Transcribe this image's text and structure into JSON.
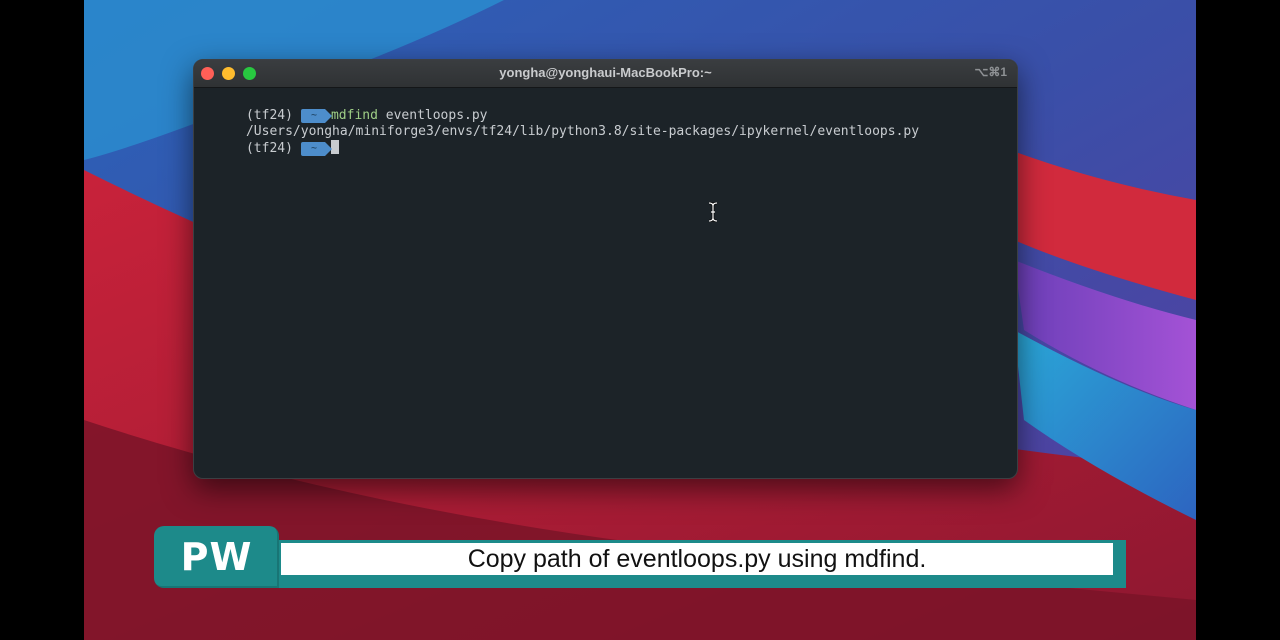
{
  "window": {
    "title": "yongha@yonghaui-MacBookPro:~",
    "shortcut": "⌥⌘1"
  },
  "terminal": {
    "lines": [
      {
        "env": "(tf24)",
        "badge": "~",
        "command": "mdfind",
        "args": "eventloops.py"
      },
      {
        "output": "/Users/yongha/miniforge3/envs/tf24/lib/python3.8/site-packages/ipykernel/eventloops.py"
      },
      {
        "env": "(tf24)",
        "badge": "~"
      }
    ]
  },
  "caption": {
    "logo": "PW",
    "text": "Copy path of eventloops.py using mdfind."
  },
  "icons": {
    "cursor": "text-ibeam-icon"
  }
}
